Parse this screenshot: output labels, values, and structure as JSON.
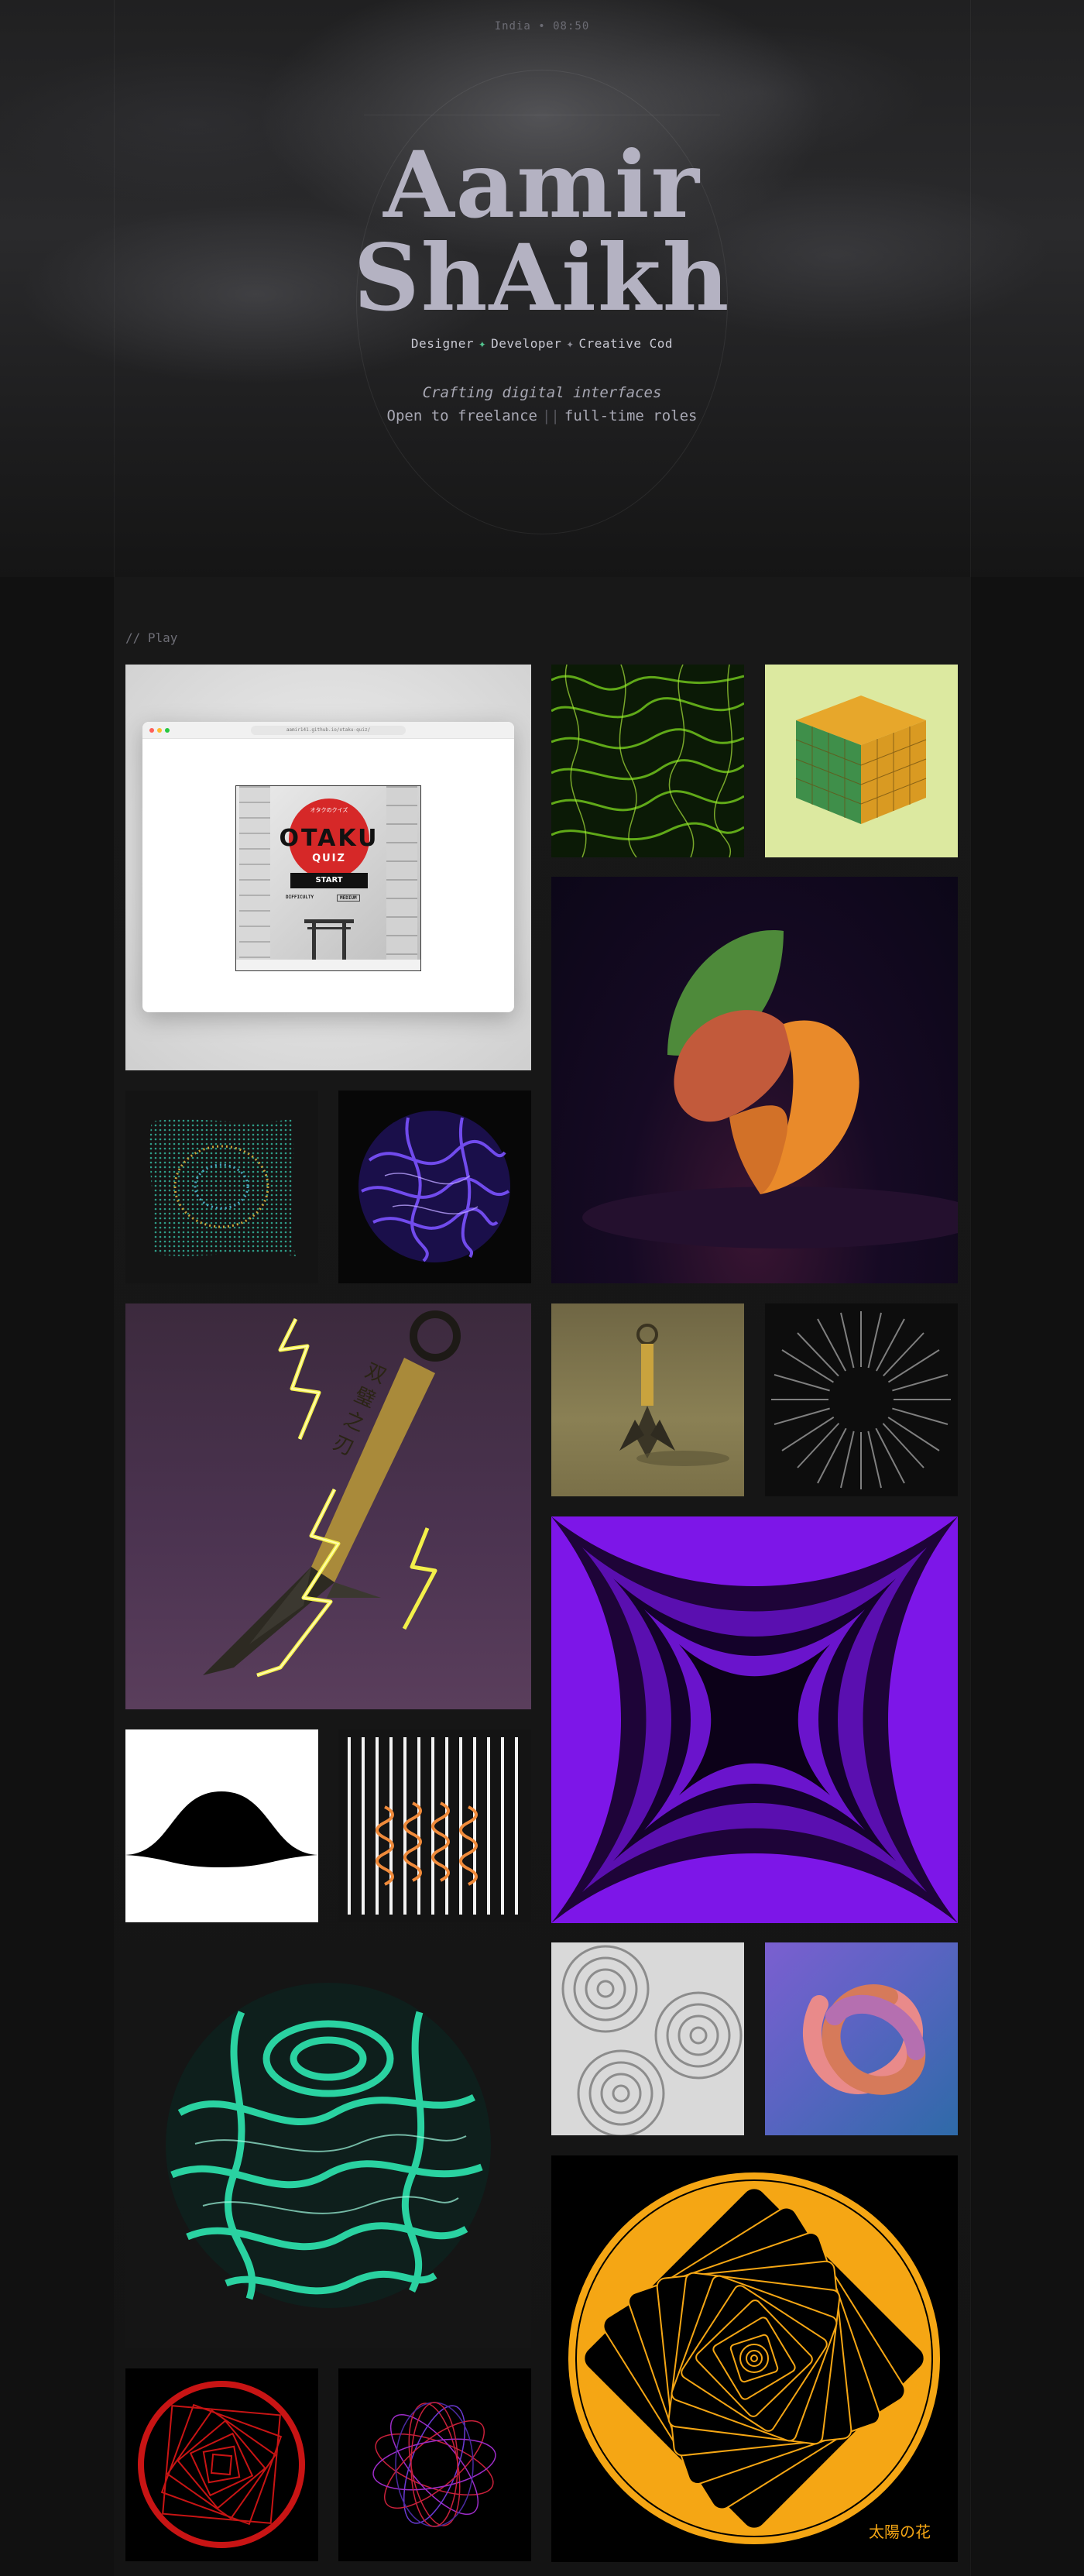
{
  "header": {
    "location_time": "India • 08:50",
    "name_line1": "Aamir",
    "name_line2": "ShAikh",
    "roles": [
      "Designer",
      "Developer",
      "Creative Cod"
    ],
    "tagline_line1": "Crafting digital interfaces",
    "tagline_line2_a": "Open to freelance",
    "tagline_line2_sep": "||",
    "tagline_line2_b": "full-time roles"
  },
  "section": {
    "label": "// Play"
  },
  "otaku": {
    "url": "aamir141.github.io/otaku-quiz/",
    "kana": "オタクのクイズ",
    "title": "OTAKU",
    "subtitle": "QUIZ",
    "start": "START",
    "difficulty_label": "DIFFICULTY",
    "difficulty_value": "MEDIUM"
  },
  "kunai": {
    "kanji": "双璧之刃"
  },
  "sun_flower": {
    "caption": "太陽の花"
  },
  "colors": {
    "accent_green": "#53c48f",
    "hero_text": "#b4b2c2",
    "page_bg": "#111111"
  }
}
